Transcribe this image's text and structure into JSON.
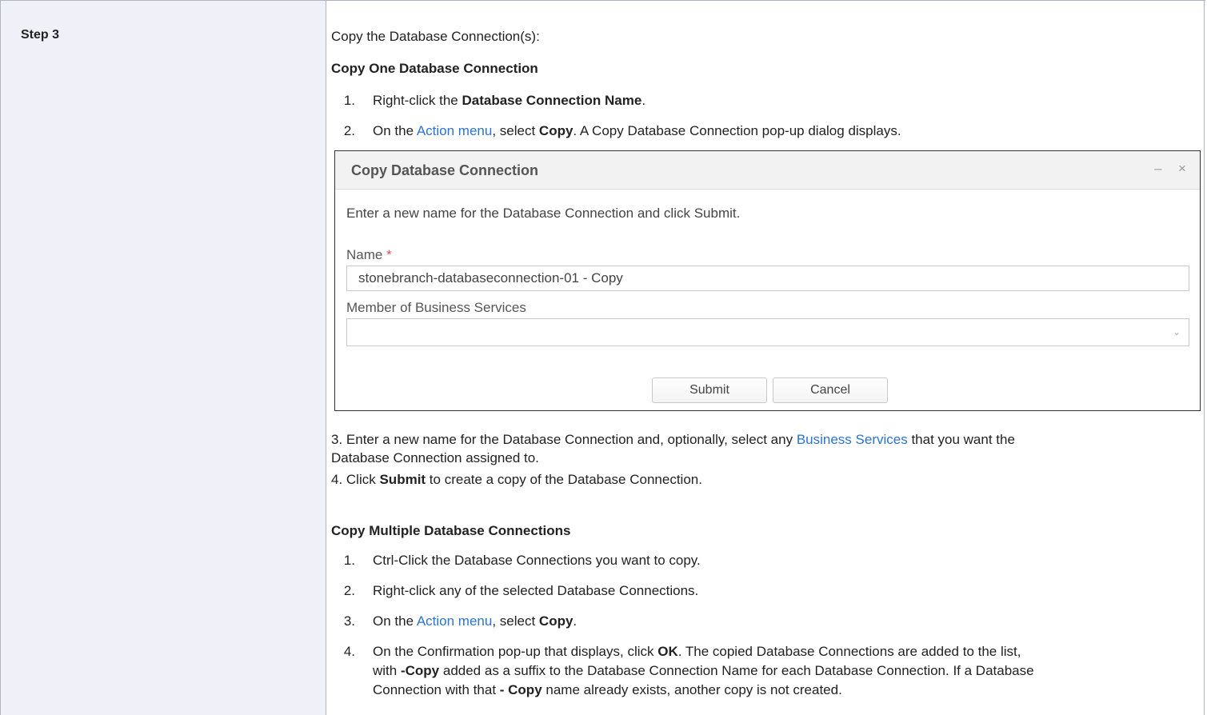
{
  "step": {
    "label": "Step 3"
  },
  "intro": "Copy the Database Connection(s):",
  "section1": {
    "heading": "Copy One Database Connection",
    "items": [
      {
        "num": "1.",
        "pre": "Right-click the ",
        "bold": "Database Connection Name",
        "post": "."
      },
      {
        "num": "2.",
        "pre": "On the ",
        "link": "Action menu",
        "mid": ", select ",
        "bold": "Copy",
        "post": ". A Copy Database Connection pop-up dialog displays."
      }
    ]
  },
  "dialog": {
    "title": "Copy Database Connection",
    "minimize": "–",
    "close": "×",
    "instruction": "Enter a new name for the Database Connection and click Submit.",
    "name_label": "Name",
    "required_mark": "*",
    "name_value": "stonebranch-databaseconnection-01 - Copy",
    "services_label": "Member of Business Services",
    "services_value": "",
    "chevron": "⌄",
    "submit": "Submit",
    "cancel": "Cancel"
  },
  "after": {
    "line3_pre": "3. Enter a new name for the Database Connection and, optionally, select any ",
    "line3_link": "Business Services",
    "line3_post": " that you want the",
    "line3b": "Database Connection assigned to.",
    "line4_pre": "4. Click ",
    "line4_bold": "Submit",
    "line4_post": " to create a copy of the Database Connection."
  },
  "section2": {
    "heading": "Copy Multiple Database Connections",
    "item1": {
      "num": "1.",
      "text": "Ctrl-Click the Database Connections you want to copy."
    },
    "item2": {
      "num": "2.",
      "text": "Right-click any of the selected Database Connections."
    },
    "item3": {
      "num": "3.",
      "pre": "On the ",
      "link": "Action menu",
      "mid": ", select ",
      "bold": "Copy",
      "post": "."
    },
    "item4": {
      "num": "4.",
      "l1_pre": "On the Confirmation pop-up that displays, click ",
      "l1_bold": "OK",
      "l1_post": ". The copied Database Connections are added to the list,",
      "l2_pre": "with ",
      "l2_bold": "-Copy",
      "l2_post": " added as a suffix to the Database Connection Name for each Database Connection. If a Database",
      "l3_pre": "Connection with that ",
      "l3_bold": "- Copy",
      "l3_post": " name already exists, another copy is not created."
    }
  }
}
